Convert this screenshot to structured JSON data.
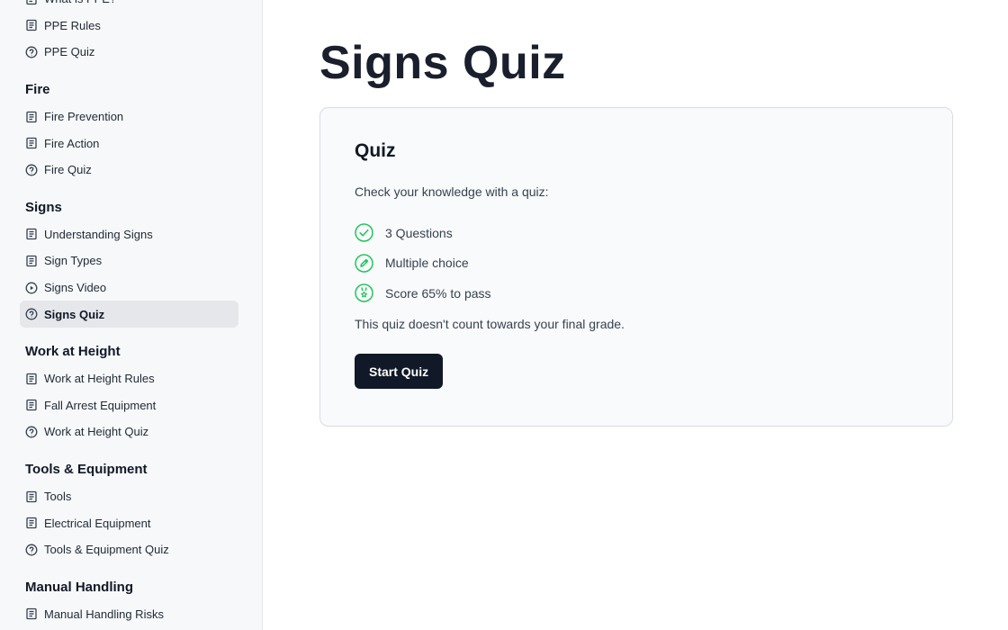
{
  "sidebar": {
    "sections": [
      {
        "title": "",
        "items": [
          {
            "label": "What is PPE?",
            "icon": "document-icon",
            "active": false
          },
          {
            "label": "PPE Rules",
            "icon": "document-icon",
            "active": false
          },
          {
            "label": "PPE Quiz",
            "icon": "question-circle-icon",
            "active": false
          }
        ]
      },
      {
        "title": "Fire",
        "items": [
          {
            "label": "Fire Prevention",
            "icon": "document-icon",
            "active": false
          },
          {
            "label": "Fire Action",
            "icon": "document-icon",
            "active": false
          },
          {
            "label": "Fire Quiz",
            "icon": "question-circle-icon",
            "active": false
          }
        ]
      },
      {
        "title": "Signs",
        "items": [
          {
            "label": "Understanding Signs",
            "icon": "document-icon",
            "active": false
          },
          {
            "label": "Sign Types",
            "icon": "document-icon",
            "active": false
          },
          {
            "label": "Signs Video",
            "icon": "play-circle-icon",
            "active": false
          },
          {
            "label": "Signs Quiz",
            "icon": "question-circle-icon",
            "active": true
          }
        ]
      },
      {
        "title": "Work at Height",
        "items": [
          {
            "label": "Work at Height Rules",
            "icon": "document-icon",
            "active": false
          },
          {
            "label": "Fall Arrest Equipment",
            "icon": "document-icon",
            "active": false
          },
          {
            "label": "Work at Height Quiz",
            "icon": "question-circle-icon",
            "active": false
          }
        ]
      },
      {
        "title": "Tools & Equipment",
        "items": [
          {
            "label": "Tools",
            "icon": "document-icon",
            "active": false
          },
          {
            "label": "Electrical Equipment",
            "icon": "document-icon",
            "active": false
          },
          {
            "label": "Tools & Equipment Quiz",
            "icon": "question-circle-icon",
            "active": false
          }
        ]
      },
      {
        "title": "Manual Handling",
        "items": [
          {
            "label": "Manual Handling Risks",
            "icon": "document-icon",
            "active": false
          }
        ]
      }
    ]
  },
  "main": {
    "page_title": "Signs Quiz",
    "card": {
      "heading": "Quiz",
      "intro": "Check your knowledge with a quiz:",
      "features": [
        {
          "text": "3 Questions",
          "icon": "check-circle-icon"
        },
        {
          "text": "Multiple choice",
          "icon": "pencil-circle-icon"
        },
        {
          "text": "Score 65% to pass",
          "icon": "medal-circle-icon"
        }
      ],
      "note": "This quiz doesn't count towards your final grade.",
      "start_label": "Start Quiz"
    }
  },
  "colors": {
    "accent_green": "#22c55e",
    "button_dark": "#111827",
    "sidebar_bg": "#f7f8f9",
    "active_item_bg": "#e5e7eb"
  }
}
